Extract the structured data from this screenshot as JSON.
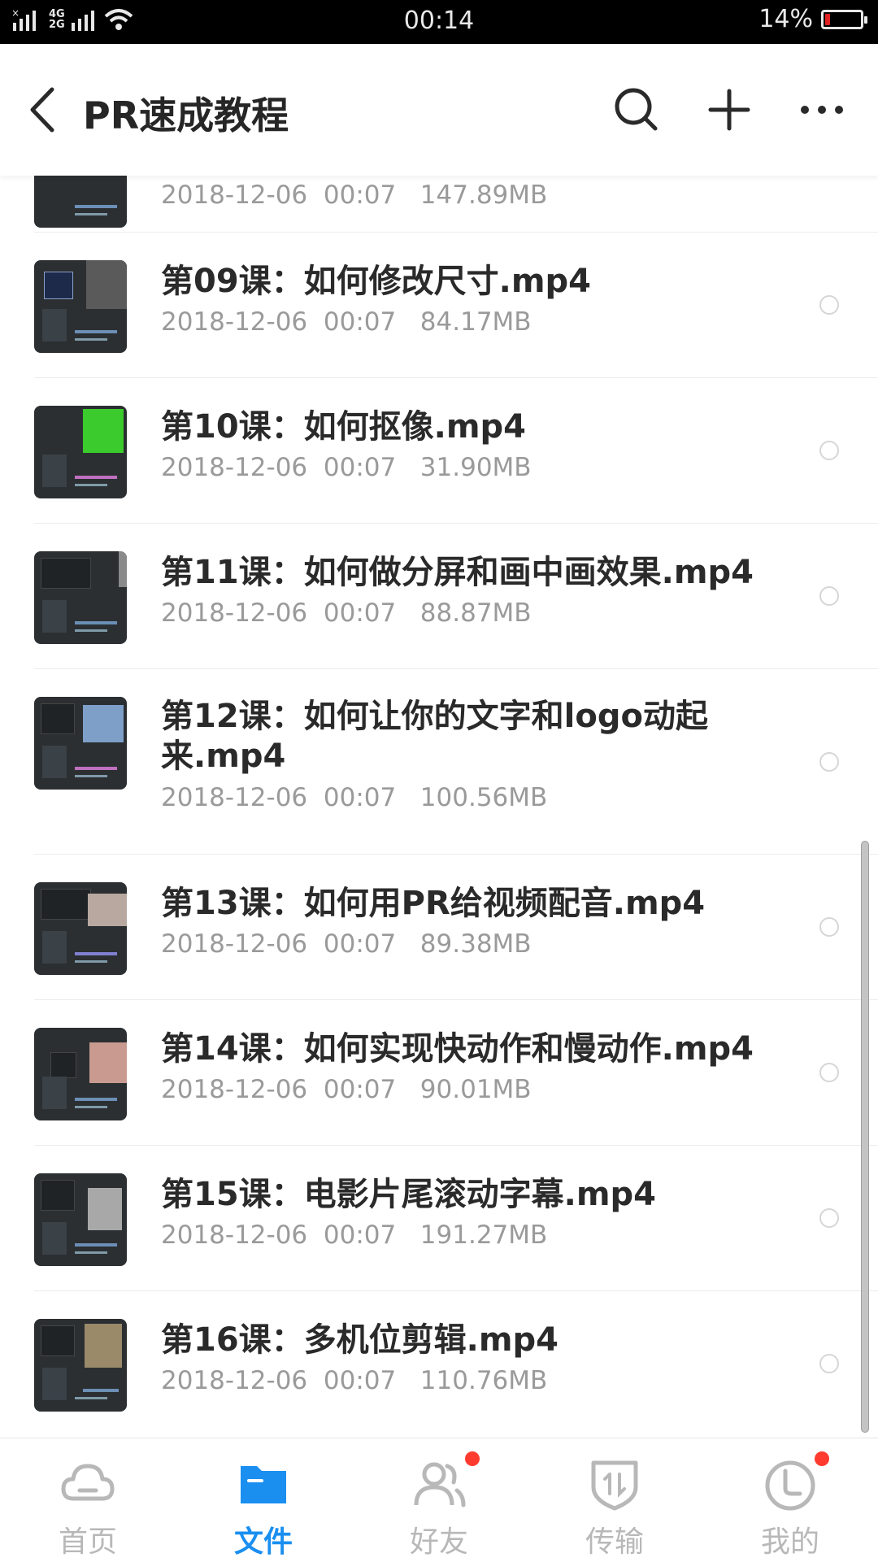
{
  "status": {
    "time": "00:14",
    "battery": "14%",
    "network_top": "4G",
    "network_bottom": "2G",
    "battery_level": 0.14
  },
  "header": {
    "title": "PR速成教程"
  },
  "files": [
    {
      "title": "",
      "date": "2018-12-06",
      "time": "00:07",
      "size": "147.89MB"
    },
    {
      "title": "第09课：如何修改尺寸.mp4",
      "date": "2018-12-06",
      "time": "00:07",
      "size": "84.17MB"
    },
    {
      "title": "第10课：如何抠像.mp4",
      "date": "2018-12-06",
      "time": "00:07",
      "size": "31.90MB"
    },
    {
      "title": "第11课：如何做分屏和画中画效果.mp4",
      "date": "2018-12-06",
      "time": "00:07",
      "size": "88.87MB"
    },
    {
      "title": "第12课：如何让你的文字和logo动起来.mp4",
      "date": "2018-12-06",
      "time": "00:07",
      "size": "100.56MB"
    },
    {
      "title": "第13课：如何用PR给视频配音.mp4",
      "date": "2018-12-06",
      "time": "00:07",
      "size": "89.38MB"
    },
    {
      "title": "第14课：如何实现快动作和慢动作.mp4",
      "date": "2018-12-06",
      "time": "00:07",
      "size": "90.01MB"
    },
    {
      "title": "第15课：电影片尾滚动字幕.mp4",
      "date": "2018-12-06",
      "time": "00:07",
      "size": "191.27MB"
    },
    {
      "title": "第16课：多机位剪辑.mp4",
      "date": "2018-12-06",
      "time": "00:07",
      "size": "110.76MB"
    }
  ],
  "tabs": [
    {
      "label": "首页",
      "icon": "cloud-icon",
      "active": false,
      "badge": false
    },
    {
      "label": "文件",
      "icon": "folder-icon",
      "active": true,
      "badge": false
    },
    {
      "label": "好友",
      "icon": "friends-icon",
      "active": false,
      "badge": true
    },
    {
      "label": "传输",
      "icon": "transfer-icon",
      "active": false,
      "badge": false
    },
    {
      "label": "我的",
      "icon": "profile-icon",
      "active": false,
      "badge": true
    }
  ],
  "colors": {
    "accent": "#1a8ff0",
    "badge": "#ff3b30",
    "status_bar": "#000000"
  }
}
